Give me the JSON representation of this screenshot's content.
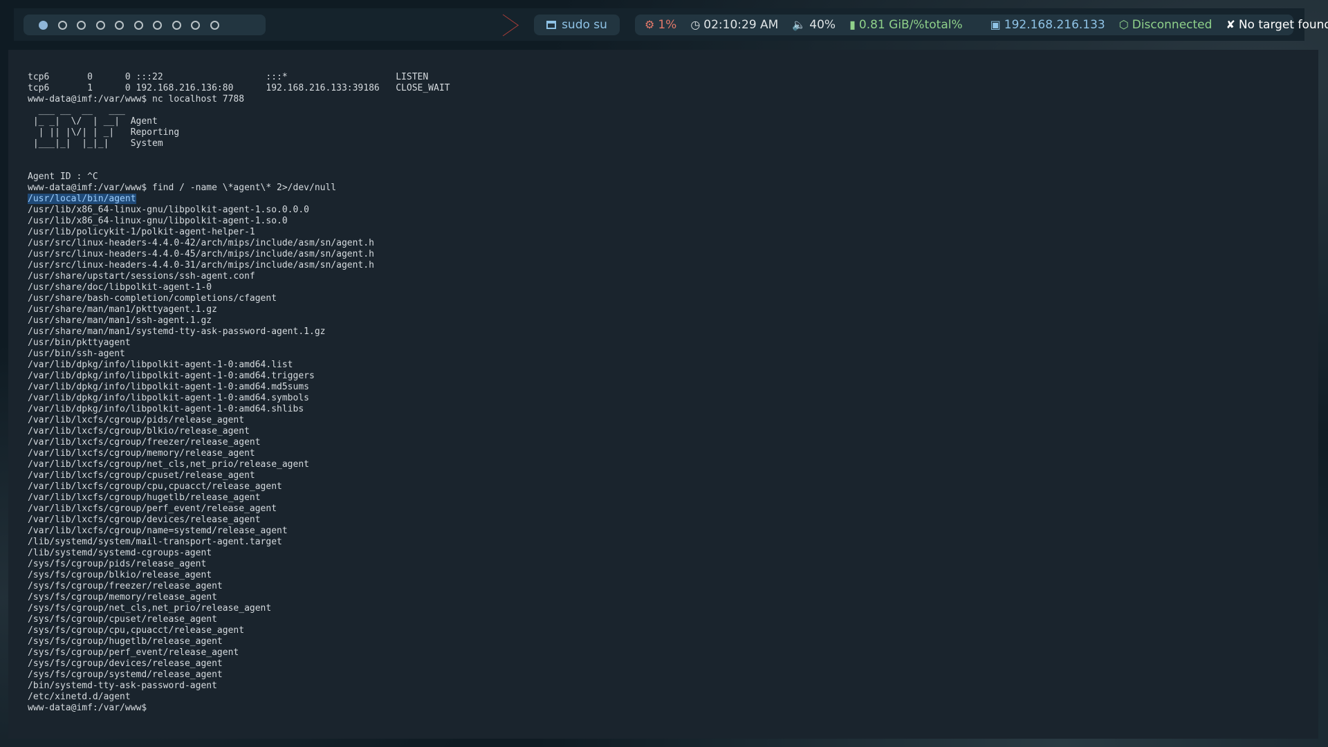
{
  "topbar": {
    "workspaces": [
      {
        "active": true
      },
      {
        "active": false
      },
      {
        "active": false
      },
      {
        "active": false
      },
      {
        "active": false
      },
      {
        "active": false
      },
      {
        "active": false
      },
      {
        "active": false
      },
      {
        "active": false
      },
      {
        "active": false
      }
    ],
    "window_title": "sudo su",
    "cpu": "1%",
    "clock": "02:10:29 AM",
    "volume": "40%",
    "memory": "0.81 GiB/%total%",
    "ip": "192.168.216.133",
    "vpn": "Disconnected",
    "target": "No target found!",
    "icons": {
      "window": "window-icon",
      "cpu": "cpu-icon",
      "clock": "clock-icon",
      "volume": "speaker-icon",
      "memory": "memory-icon",
      "ip": "monitor-icon",
      "vpn": "shield-icon",
      "target": "crosshair-icon"
    },
    "colors": {
      "cpu": "#e3796a",
      "memory": "#8fd18a",
      "ip": "#8fc3e6",
      "vpn": "#8fd18a",
      "separator": "#e05a5a"
    }
  },
  "terminal": {
    "highlight_color": "#1f4a78",
    "lines": [
      "tcp6       0      0 :::22                   :::*                    LISTEN",
      "tcp6       1      0 192.168.216.136:80      192.168.216.133:39186   CLOSE_WAIT",
      "www-data@imf:/var/www$ nc localhost 7788",
      "  ___ __  __   ___",
      " |_ _|  \\/  | __|  Agent",
      "  | || |\\/| | _|   Reporting",
      " |___|_|  |_|_|    System",
      "",
      "",
      "Agent ID : ^C",
      "www-data@imf:/var/www$ find / -name \\*agent\\* 2>/dev/null",
      "/usr/local/bin/agent",
      "/usr/lib/x86_64-linux-gnu/libpolkit-agent-1.so.0.0.0",
      "/usr/lib/x86_64-linux-gnu/libpolkit-agent-1.so.0",
      "/usr/lib/policykit-1/polkit-agent-helper-1",
      "/usr/src/linux-headers-4.4.0-42/arch/mips/include/asm/sn/agent.h",
      "/usr/src/linux-headers-4.4.0-45/arch/mips/include/asm/sn/agent.h",
      "/usr/src/linux-headers-4.4.0-31/arch/mips/include/asm/sn/agent.h",
      "/usr/share/upstart/sessions/ssh-agent.conf",
      "/usr/share/doc/libpolkit-agent-1-0",
      "/usr/share/bash-completion/completions/cfagent",
      "/usr/share/man/man1/pkttyagent.1.gz",
      "/usr/share/man/man1/ssh-agent.1.gz",
      "/usr/share/man/man1/systemd-tty-ask-password-agent.1.gz",
      "/usr/bin/pkttyagent",
      "/usr/bin/ssh-agent",
      "/var/lib/dpkg/info/libpolkit-agent-1-0:amd64.list",
      "/var/lib/dpkg/info/libpolkit-agent-1-0:amd64.triggers",
      "/var/lib/dpkg/info/libpolkit-agent-1-0:amd64.md5sums",
      "/var/lib/dpkg/info/libpolkit-agent-1-0:amd64.symbols",
      "/var/lib/dpkg/info/libpolkit-agent-1-0:amd64.shlibs",
      "/var/lib/lxcfs/cgroup/pids/release_agent",
      "/var/lib/lxcfs/cgroup/blkio/release_agent",
      "/var/lib/lxcfs/cgroup/freezer/release_agent",
      "/var/lib/lxcfs/cgroup/memory/release_agent",
      "/var/lib/lxcfs/cgroup/net_cls,net_prio/release_agent",
      "/var/lib/lxcfs/cgroup/cpuset/release_agent",
      "/var/lib/lxcfs/cgroup/cpu,cpuacct/release_agent",
      "/var/lib/lxcfs/cgroup/hugetlb/release_agent",
      "/var/lib/lxcfs/cgroup/perf_event/release_agent",
      "/var/lib/lxcfs/cgroup/devices/release_agent",
      "/var/lib/lxcfs/cgroup/name=systemd/release_agent",
      "/lib/systemd/system/mail-transport-agent.target",
      "/lib/systemd/systemd-cgroups-agent",
      "/sys/fs/cgroup/pids/release_agent",
      "/sys/fs/cgroup/blkio/release_agent",
      "/sys/fs/cgroup/freezer/release_agent",
      "/sys/fs/cgroup/memory/release_agent",
      "/sys/fs/cgroup/net_cls,net_prio/release_agent",
      "/sys/fs/cgroup/cpuset/release_agent",
      "/sys/fs/cgroup/cpu,cpuacct/release_agent",
      "/sys/fs/cgroup/hugetlb/release_agent",
      "/sys/fs/cgroup/perf_event/release_agent",
      "/sys/fs/cgroup/devices/release_agent",
      "/sys/fs/cgroup/systemd/release_agent",
      "/bin/systemd-tty-ask-password-agent",
      "/etc/xinetd.d/agent",
      "www-data@imf:/var/www$ "
    ],
    "highlighted_line_index": 11
  }
}
